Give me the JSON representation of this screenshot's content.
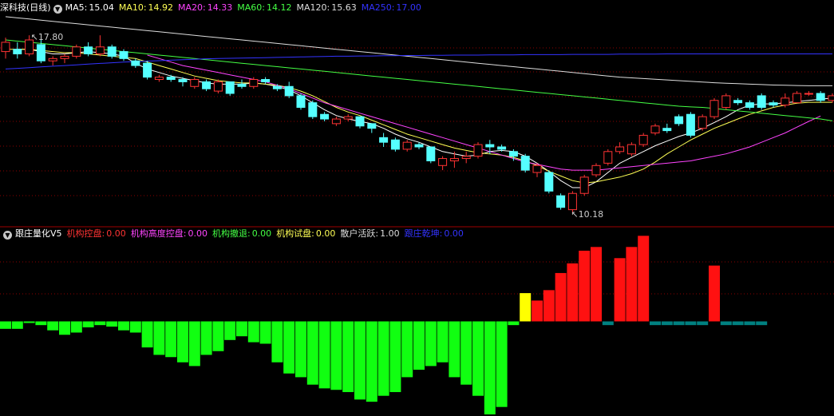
{
  "top_panel": {
    "title": "深科技(日线)",
    "ma": [
      {
        "label": "MA5:",
        "value": "15.04",
        "color": "#ffffff"
      },
      {
        "label": "MA10:",
        "value": "14.92",
        "color": "#ffff55"
      },
      {
        "label": "MA20:",
        "value": "14.33",
        "color": "#ff44ff"
      },
      {
        "label": "MA60:",
        "value": "14.12",
        "color": "#44ff44"
      },
      {
        "label": "MA120:",
        "value": "15.63",
        "color": "#dddddd"
      },
      {
        "label": "MA250:",
        "value": "17.00",
        "color": "#3333ff"
      }
    ],
    "high_label": "17.80",
    "low_label": "10.18"
  },
  "bottom_panel": {
    "title": "跟庄量化V5",
    "items": [
      {
        "label": "机构控盘:",
        "value": "0.00",
        "color": "#ff3333"
      },
      {
        "label": "机构高度控盘:",
        "value": "0.00",
        "color": "#ff44ff"
      },
      {
        "label": "机构撤退:",
        "value": "0.00",
        "color": "#44ff44"
      },
      {
        "label": "机构试盘:",
        "value": "0.00",
        "color": "#ffff55"
      },
      {
        "label": "散户活跃:",
        "value": "1.00",
        "color": "#dddddd"
      },
      {
        "label": "跟庄乾坤:",
        "value": "0.00",
        "color": "#3333ff"
      }
    ]
  },
  "colors": {
    "up": "#ff3333",
    "down": "#55ffff",
    "grid": "#8b0000",
    "divider": "#a00000"
  },
  "chart_data": [
    {
      "type": "candlestick",
      "ylim": [
        9.6,
        18.7
      ],
      "candles": [
        {
          "o": 17.1,
          "h": 17.7,
          "l": 16.8,
          "c": 17.5
        },
        {
          "o": 17.2,
          "h": 17.5,
          "l": 16.8,
          "c": 17.0
        },
        {
          "o": 17.0,
          "h": 17.8,
          "l": 16.9,
          "c": 17.6
        },
        {
          "o": 17.4,
          "h": 17.6,
          "l": 16.6,
          "c": 16.7
        },
        {
          "o": 16.7,
          "h": 16.9,
          "l": 16.5,
          "c": 16.8
        },
        {
          "o": 16.8,
          "h": 17.0,
          "l": 16.6,
          "c": 16.9
        },
        {
          "o": 16.9,
          "h": 17.4,
          "l": 16.8,
          "c": 17.3
        },
        {
          "o": 17.3,
          "h": 17.5,
          "l": 16.9,
          "c": 17.0
        },
        {
          "o": 17.0,
          "h": 17.8,
          "l": 16.9,
          "c": 17.3
        },
        {
          "o": 17.3,
          "h": 17.4,
          "l": 16.8,
          "c": 16.9
        },
        {
          "o": 17.1,
          "h": 17.2,
          "l": 16.7,
          "c": 16.8
        },
        {
          "o": 16.7,
          "h": 16.8,
          "l": 16.4,
          "c": 16.5
        },
        {
          "o": 16.6,
          "h": 16.7,
          "l": 15.9,
          "c": 16.0
        },
        {
          "o": 15.9,
          "h": 16.1,
          "l": 15.8,
          "c": 16.0
        },
        {
          "o": 16.0,
          "h": 16.1,
          "l": 15.8,
          "c": 15.9
        },
        {
          "o": 15.9,
          "h": 16.0,
          "l": 15.6,
          "c": 15.8
        },
        {
          "o": 15.6,
          "h": 16.0,
          "l": 15.5,
          "c": 15.9
        },
        {
          "o": 15.8,
          "h": 15.9,
          "l": 15.4,
          "c": 15.5
        },
        {
          "o": 15.4,
          "h": 15.9,
          "l": 15.3,
          "c": 15.8
        },
        {
          "o": 15.8,
          "h": 15.8,
          "l": 15.2,
          "c": 15.3
        },
        {
          "o": 15.7,
          "h": 15.9,
          "l": 15.5,
          "c": 15.6
        },
        {
          "o": 15.6,
          "h": 16.0,
          "l": 15.5,
          "c": 15.9
        },
        {
          "o": 15.9,
          "h": 16.0,
          "l": 15.7,
          "c": 15.8
        },
        {
          "o": 15.6,
          "h": 15.7,
          "l": 15.4,
          "c": 15.5
        },
        {
          "o": 15.6,
          "h": 15.8,
          "l": 15.1,
          "c": 15.2
        },
        {
          "o": 15.2,
          "h": 15.3,
          "l": 14.6,
          "c": 14.7
        },
        {
          "o": 14.9,
          "h": 15.0,
          "l": 14.2,
          "c": 14.3
        },
        {
          "o": 14.4,
          "h": 14.5,
          "l": 14.1,
          "c": 14.2
        },
        {
          "o": 14.0,
          "h": 14.3,
          "l": 13.9,
          "c": 14.2
        },
        {
          "o": 14.2,
          "h": 14.4,
          "l": 14.1,
          "c": 14.3
        },
        {
          "o": 14.3,
          "h": 14.3,
          "l": 13.8,
          "c": 13.9
        },
        {
          "o": 14.0,
          "h": 14.0,
          "l": 13.6,
          "c": 13.8
        },
        {
          "o": 13.4,
          "h": 13.6,
          "l": 13.0,
          "c": 13.2
        },
        {
          "o": 13.3,
          "h": 13.4,
          "l": 12.8,
          "c": 12.9
        },
        {
          "o": 12.9,
          "h": 13.3,
          "l": 12.8,
          "c": 13.2
        },
        {
          "o": 13.1,
          "h": 13.2,
          "l": 12.9,
          "c": 13.0
        },
        {
          "o": 13.0,
          "h": 13.0,
          "l": 12.3,
          "c": 12.4
        },
        {
          "o": 12.2,
          "h": 12.6,
          "l": 12.0,
          "c": 12.5
        },
        {
          "o": 12.4,
          "h": 12.8,
          "l": 12.1,
          "c": 12.5
        },
        {
          "o": 12.5,
          "h": 12.8,
          "l": 12.3,
          "c": 12.6
        },
        {
          "o": 12.6,
          "h": 13.2,
          "l": 12.5,
          "c": 13.1
        },
        {
          "o": 13.1,
          "h": 13.3,
          "l": 12.7,
          "c": 13.0
        },
        {
          "o": 13.0,
          "h": 13.1,
          "l": 12.8,
          "c": 12.9
        },
        {
          "o": 12.8,
          "h": 12.9,
          "l": 12.4,
          "c": 12.6
        },
        {
          "o": 12.6,
          "h": 12.7,
          "l": 11.9,
          "c": 12.0
        },
        {
          "o": 11.9,
          "h": 12.3,
          "l": 11.7,
          "c": 12.2
        },
        {
          "o": 11.9,
          "h": 12.0,
          "l": 11.0,
          "c": 11.1
        },
        {
          "o": 10.9,
          "h": 11.0,
          "l": 10.3,
          "c": 10.4
        },
        {
          "o": 10.3,
          "h": 11.1,
          "l": 10.18,
          "c": 11.0
        },
        {
          "o": 11.0,
          "h": 11.8,
          "l": 10.9,
          "c": 11.7
        },
        {
          "o": 11.8,
          "h": 12.3,
          "l": 11.7,
          "c": 12.2
        },
        {
          "o": 12.3,
          "h": 12.9,
          "l": 12.2,
          "c": 12.8
        },
        {
          "o": 12.8,
          "h": 13.2,
          "l": 12.7,
          "c": 13.0
        },
        {
          "o": 12.7,
          "h": 13.2,
          "l": 12.6,
          "c": 13.1
        },
        {
          "o": 13.1,
          "h": 13.6,
          "l": 13.0,
          "c": 13.5
        },
        {
          "o": 13.6,
          "h": 14.0,
          "l": 13.5,
          "c": 13.9
        },
        {
          "o": 13.8,
          "h": 14.0,
          "l": 13.6,
          "c": 13.7
        },
        {
          "o": 14.3,
          "h": 14.4,
          "l": 13.9,
          "c": 14.0
        },
        {
          "o": 14.4,
          "h": 14.5,
          "l": 13.4,
          "c": 13.5
        },
        {
          "o": 13.8,
          "h": 14.4,
          "l": 13.7,
          "c": 14.3
        },
        {
          "o": 14.3,
          "h": 15.1,
          "l": 14.2,
          "c": 15.0
        },
        {
          "o": 14.7,
          "h": 15.3,
          "l": 14.6,
          "c": 15.2
        },
        {
          "o": 15.0,
          "h": 15.1,
          "l": 14.8,
          "c": 14.9
        },
        {
          "o": 14.9,
          "h": 15.0,
          "l": 14.6,
          "c": 14.7
        },
        {
          "o": 15.2,
          "h": 15.3,
          "l": 14.6,
          "c": 14.7
        },
        {
          "o": 14.9,
          "h": 15.0,
          "l": 14.7,
          "c": 14.8
        },
        {
          "o": 14.8,
          "h": 15.3,
          "l": 14.7,
          "c": 15.1
        },
        {
          "o": 14.9,
          "h": 15.4,
          "l": 14.9,
          "c": 15.3
        },
        {
          "o": 15.3,
          "h": 15.4,
          "l": 15.2,
          "c": 15.3
        },
        {
          "o": 15.3,
          "h": 15.4,
          "l": 14.9,
          "c": 15.0
        },
        {
          "o": 15.0,
          "h": 15.3,
          "l": 14.9,
          "c": 15.2
        }
      ],
      "ma_series": [
        {
          "name": "MA5",
          "color": "#ffffff",
          "from": 1,
          "values": [
            17.2,
            17.2,
            17.1,
            17.0,
            17.0,
            17.05,
            17.1,
            17.05,
            17.0,
            16.9,
            16.6,
            16.35,
            16.2,
            16.05,
            15.95,
            15.85,
            15.75,
            15.7,
            15.7,
            15.7,
            15.75,
            15.7,
            15.6,
            15.45,
            15.2,
            14.9,
            14.6,
            14.35,
            14.2,
            14.1,
            14.0,
            13.8,
            13.55,
            13.35,
            13.2,
            13.0,
            12.8,
            12.7,
            12.6,
            12.65,
            12.8,
            12.85,
            12.8,
            12.6,
            12.3,
            11.95,
            11.55,
            11.25,
            11.25,
            11.5,
            11.9,
            12.3,
            12.55,
            12.8,
            13.05,
            13.25,
            13.45,
            13.6,
            13.8,
            14.05,
            14.3,
            14.6,
            14.8,
            14.85,
            14.85,
            14.9,
            14.95,
            15.0,
            15.05,
            15.1
          ]
        },
        {
          "name": "MA10",
          "color": "#ffff55",
          "from": 0,
          "values": [
            17.2,
            17.2,
            17.2,
            17.15,
            17.1,
            17.05,
            17.05,
            17.0,
            16.95,
            16.9,
            16.85,
            16.8,
            16.65,
            16.5,
            16.35,
            16.2,
            16.05,
            15.95,
            15.85,
            15.8,
            15.75,
            15.75,
            15.7,
            15.65,
            15.55,
            15.4,
            15.2,
            14.95,
            14.7,
            14.5,
            14.35,
            14.15,
            13.95,
            13.75,
            13.55,
            13.4,
            13.25,
            13.1,
            12.95,
            12.85,
            12.75,
            12.7,
            12.65,
            12.55,
            12.4,
            12.2,
            11.95,
            11.75,
            11.55,
            11.45,
            11.5,
            11.6,
            11.7,
            11.85,
            12.05,
            12.35,
            12.7,
            13.0,
            13.3,
            13.55,
            13.8,
            14.0,
            14.2,
            14.4,
            14.55,
            14.7,
            14.8,
            14.88,
            14.92,
            14.92,
            14.92
          ]
        },
        {
          "name": "MA20",
          "color": "#ff44ff",
          "from": 12,
          "values": [
            16.95,
            16.8,
            16.65,
            16.5,
            16.4,
            16.3,
            16.2,
            16.1,
            16.0,
            15.9,
            15.8,
            15.65,
            15.5,
            15.3,
            15.1,
            14.9,
            14.75,
            14.6,
            14.45,
            14.3,
            14.15,
            14.0,
            13.85,
            13.7,
            13.55,
            13.4,
            13.25,
            13.1,
            12.95,
            12.8,
            12.65,
            12.5,
            12.35,
            12.25,
            12.15,
            12.05,
            12.0,
            12.0,
            12.0,
            12.05,
            12.1,
            12.15,
            12.2,
            12.25,
            12.3,
            12.35,
            12.4,
            12.5,
            12.6,
            12.7,
            12.85,
            13.0,
            13.2,
            13.4,
            13.6,
            13.85,
            14.1,
            14.33
          ]
        },
        {
          "name": "MA60",
          "color": "#44ff44",
          "from": 0,
          "values": [
            17.6,
            17.55,
            17.5,
            17.45,
            17.4,
            17.35,
            17.3,
            17.25,
            17.2,
            17.15,
            17.1,
            17.05,
            17.0,
            16.95,
            16.9,
            16.85,
            16.8,
            16.75,
            16.7,
            16.65,
            16.6,
            16.55,
            16.5,
            16.45,
            16.4,
            16.35,
            16.3,
            16.25,
            16.2,
            16.15,
            16.1,
            16.05,
            16.0,
            15.95,
            15.9,
            15.85,
            15.8,
            15.75,
            15.7,
            15.65,
            15.6,
            15.55,
            15.5,
            15.45,
            15.4,
            15.35,
            15.3,
            15.25,
            15.2,
            15.15,
            15.1,
            15.05,
            15.0,
            14.95,
            14.9,
            14.85,
            14.8,
            14.75,
            14.72,
            14.7,
            14.65,
            14.6,
            14.55,
            14.5,
            14.45,
            14.4,
            14.35,
            14.3,
            14.25,
            14.2,
            14.12
          ]
        },
        {
          "name": "MA120",
          "color": "#dddddd",
          "from": 0,
          "values": [
            18.6,
            18.55,
            18.5,
            18.45,
            18.4,
            18.35,
            18.3,
            18.25,
            18.2,
            18.15,
            18.1,
            18.05,
            18.0,
            17.95,
            17.9,
            17.85,
            17.8,
            17.75,
            17.7,
            17.65,
            17.6,
            17.55,
            17.5,
            17.45,
            17.4,
            17.35,
            17.3,
            17.25,
            17.2,
            17.15,
            17.1,
            17.05,
            17.0,
            16.95,
            16.9,
            16.85,
            16.8,
            16.75,
            16.7,
            16.65,
            16.6,
            16.55,
            16.5,
            16.45,
            16.4,
            16.35,
            16.3,
            16.25,
            16.2,
            16.15,
            16.1,
            16.05,
            16.0,
            15.97,
            15.94,
            15.91,
            15.88,
            15.85,
            15.82,
            15.79,
            15.76,
            15.74,
            15.72,
            15.7,
            15.68,
            15.66,
            15.65,
            15.64,
            15.63,
            15.63,
            15.63
          ]
        },
        {
          "name": "MA250",
          "color": "#3333ff",
          "from": 0,
          "values": [
            16.35,
            16.38,
            16.41,
            16.44,
            16.47,
            16.5,
            16.53,
            16.56,
            16.59,
            16.62,
            16.65,
            16.67,
            16.69,
            16.71,
            16.73,
            16.75,
            16.77,
            16.79,
            16.8,
            16.81,
            16.82,
            16.83,
            16.84,
            16.85,
            16.86,
            16.87,
            16.88,
            16.89,
            16.9,
            16.9,
            16.91,
            16.91,
            16.92,
            16.92,
            16.93,
            16.93,
            16.94,
            16.94,
            16.95,
            16.95,
            16.95,
            16.96,
            16.96,
            16.96,
            16.97,
            16.97,
            16.97,
            16.97,
            16.98,
            16.98,
            16.98,
            16.98,
            16.99,
            16.99,
            16.99,
            16.99,
            17.0,
            17.0,
            17.0,
            17.0,
            17.0,
            17.0,
            17.0,
            17.0,
            17.0,
            17.0,
            17.0,
            17.0,
            17.0,
            17.0,
            17.0
          ]
        }
      ]
    },
    {
      "type": "bar",
      "ylim": [
        -125,
        110
      ],
      "values": [
        -10,
        -10,
        0,
        -5,
        -12,
        -18,
        -15,
        -8,
        -5,
        -7,
        -12,
        -15,
        -35,
        -45,
        -48,
        -55,
        -60,
        -45,
        -40,
        -25,
        -20,
        -28,
        -30,
        -55,
        -70,
        -75,
        -85,
        -90,
        -92,
        -95,
        -105,
        -108,
        -100,
        -95,
        -75,
        -65,
        -60,
        -55,
        -75,
        -85,
        -100,
        -125,
        -115,
        -5,
        38,
        28,
        42,
        65,
        78,
        95,
        100,
        -5,
        85,
        100,
        115,
        -5,
        -5,
        -5,
        -5,
        -5,
        75,
        -5,
        -5,
        -5,
        -5
      ],
      "bar_colors": [
        "#11ff11",
        "#11ff11",
        "#11ff11",
        "#11ff11",
        "#11ff11",
        "#11ff11",
        "#11ff11",
        "#11ff11",
        "#11ff11",
        "#11ff11",
        "#11ff11",
        "#11ff11",
        "#11ff11",
        "#11ff11",
        "#11ff11",
        "#11ff11",
        "#11ff11",
        "#11ff11",
        "#11ff11",
        "#11ff11",
        "#11ff11",
        "#11ff11",
        "#11ff11",
        "#11ff11",
        "#11ff11",
        "#11ff11",
        "#11ff11",
        "#11ff11",
        "#11ff11",
        "#11ff11",
        "#11ff11",
        "#11ff11",
        "#11ff11",
        "#11ff11",
        "#11ff11",
        "#11ff11",
        "#11ff11",
        "#11ff11",
        "#11ff11",
        "#11ff11",
        "#11ff11",
        "#11ff11",
        "#11ff11",
        "#11ff11",
        "#ffff00",
        "#ff1111",
        "#ff1111",
        "#ff1111",
        "#ff1111",
        "#ff1111",
        "#ff1111",
        "#008080",
        "#ff1111",
        "#ff1111",
        "#ff1111",
        "#008080",
        "#008080",
        "#008080",
        "#008080",
        "#008080",
        "#ff1111",
        "#008080",
        "#008080",
        "#008080",
        "#008080"
      ]
    }
  ]
}
